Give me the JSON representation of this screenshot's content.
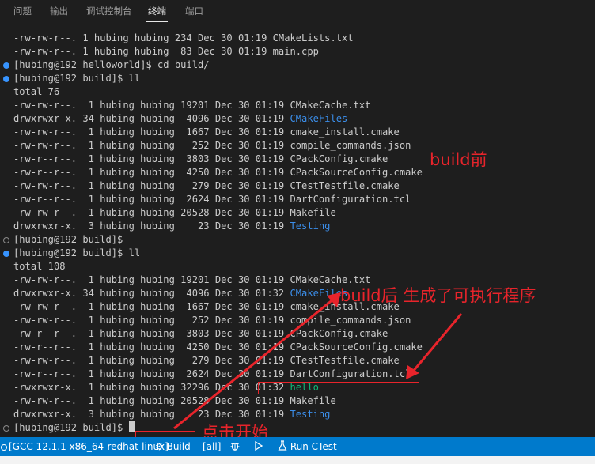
{
  "panel_tabs": [
    "问题",
    "输出",
    "调试控制台",
    "终端",
    "端口"
  ],
  "active_tab": "终端",
  "terminal_lines": [
    {
      "text": "-rw-rw-r--. 1 hubing hubing 234 Dec 30 01:19 CMakeLists.txt"
    },
    {
      "text": "-rw-rw-r--. 1 hubing hubing  83 Dec 30 01:19 main.cpp"
    },
    {
      "text": "[hubing@192 helloworld]$ cd build/",
      "marker": "filled"
    },
    {
      "text": "[hubing@192 build]$ ll",
      "marker": "filled"
    },
    {
      "text": "total 76"
    },
    {
      "text": "-rw-rw-r--.  1 hubing hubing 19201 Dec 30 01:19 CMakeCache.txt"
    },
    {
      "text": "drwxrwxr-x. 34 hubing hubing  4096 Dec 30 01:19 ",
      "name": "CMakeFiles",
      "name_style": "blue"
    },
    {
      "text": "-rw-rw-r--.  1 hubing hubing  1667 Dec 30 01:19 cmake_install.cmake"
    },
    {
      "text": "-rw-rw-r--.  1 hubing hubing   252 Dec 30 01:19 compile_commands.json"
    },
    {
      "text": "-rw-r--r--.  1 hubing hubing  3803 Dec 30 01:19 CPackConfig.cmake"
    },
    {
      "text": "-rw-r--r--.  1 hubing hubing  4250 Dec 30 01:19 CPackSourceConfig.cmake"
    },
    {
      "text": "-rw-rw-r--.  1 hubing hubing   279 Dec 30 01:19 CTestTestfile.cmake"
    },
    {
      "text": "-rw-r--r--.  1 hubing hubing  2624 Dec 30 01:19 DartConfiguration.tcl"
    },
    {
      "text": "-rw-rw-r--.  1 hubing hubing 20528 Dec 30 01:19 Makefile"
    },
    {
      "text": "drwxrwxr-x.  3 hubing hubing    23 Dec 30 01:19 ",
      "name": "Testing",
      "name_style": "blue"
    },
    {
      "text": "[hubing@192 build]$",
      "marker": "hollow"
    },
    {
      "text": "[hubing@192 build]$ ll",
      "marker": "filled"
    },
    {
      "text": "total 108"
    },
    {
      "text": "-rw-rw-r--.  1 hubing hubing 19201 Dec 30 01:19 CMakeCache.txt"
    },
    {
      "text": "drwxrwxr-x. 34 hubing hubing  4096 Dec 30 01:32 ",
      "name": "CMakeFiles",
      "name_style": "blue"
    },
    {
      "text": "-rw-rw-r--.  1 hubing hubing  1667 Dec 30 01:19 cmake_install.cmake"
    },
    {
      "text": "-rw-rw-r--.  1 hubing hubing   252 Dec 30 01:19 compile_commands.json"
    },
    {
      "text": "-rw-r--r--.  1 hubing hubing  3803 Dec 30 01:19 CPackConfig.cmake"
    },
    {
      "text": "-rw-r--r--.  1 hubing hubing  4250 Dec 30 01:19 CPackSourceConfig.cmake"
    },
    {
      "text": "-rw-rw-r--.  1 hubing hubing   279 Dec 30 01:19 CTestTestfile.cmake"
    },
    {
      "text": "-rw-r--r--.  1 hubing hubing  2624 Dec 30 01:19 DartConfiguration.tcl"
    },
    {
      "text": "-rwxrwxr-x.  1 hubing hubing 32296 Dec 30 01:32 ",
      "name": "hello",
      "name_style": "hello"
    },
    {
      "text": "-rw-rw-r--.  1 hubing hubing 20528 Dec 30 01:19 Makefile"
    },
    {
      "text": "drwxrwxr-x.  3 hubing hubing    23 Dec 30 01:19 ",
      "name": "Testing",
      "name_style": "blue"
    },
    {
      "text": "[hubing@192 build]$ ",
      "marker": "hollow",
      "cursor": true
    }
  ],
  "annotations": {
    "before": "build前",
    "after": "build后 生成了可执行程序",
    "click": "点击开始"
  },
  "status_bar": {
    "kit": "[GCC 12.1.1 x86_64-redhat-linux]",
    "build": "Build",
    "target": "[all]",
    "run_ctest": "Run CTest"
  },
  "colors": {
    "terminal_bg": "#1e1e1e",
    "status_bg": "#007acc",
    "annotation_red": "#e8242b",
    "dir_blue": "#3b8eea",
    "exec_green": "#0dbc79"
  }
}
